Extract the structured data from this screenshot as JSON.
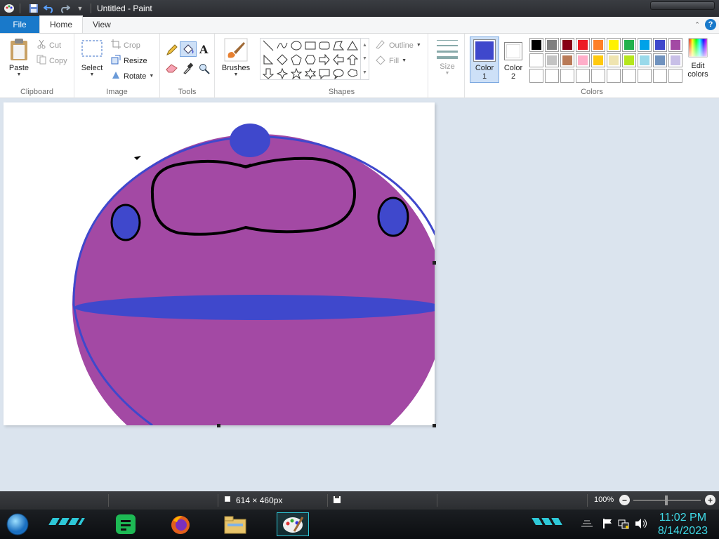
{
  "window": {
    "title": "Untitled - Paint"
  },
  "tabs": [
    {
      "label": "File"
    },
    {
      "label": "Home"
    },
    {
      "label": "View"
    }
  ],
  "ribbon": {
    "clipboard": {
      "group": "Clipboard",
      "paste": "Paste",
      "cut": "Cut",
      "copy": "Copy"
    },
    "image": {
      "group": "Image",
      "select": "Select",
      "crop": "Crop",
      "resize": "Resize",
      "rotate": "Rotate"
    },
    "tools": {
      "group": "Tools"
    },
    "brushes": {
      "label": "Brushes"
    },
    "shapes": {
      "group": "Shapes",
      "outline": "Outline",
      "fill": "Fill"
    },
    "size": {
      "label": "Size"
    },
    "colors": {
      "group": "Colors",
      "color1_label": "Color\n1",
      "color1_label_line1": "Color",
      "color1_label_line2": "1",
      "color2_label_line1": "Color",
      "color2_label_line2": "2",
      "edit_line1": "Edit",
      "edit_line2": "colors",
      "color1": "#3f48cc",
      "color2": "#ffffff",
      "palette_row1": [
        "#000000",
        "#7f7f7f",
        "#880015",
        "#ed1c24",
        "#ff7f27",
        "#fff200",
        "#22b14c",
        "#00a2e8",
        "#3f48cc",
        "#a349a4"
      ],
      "palette_row2": [
        "#ffffff",
        "#c3c3c3",
        "#b97a57",
        "#ffaec9",
        "#ffc90e",
        "#efe4b0",
        "#b5e61d",
        "#99d9ea",
        "#7092be",
        "#c8bfe7"
      ],
      "palette_row3": [
        "#ffffff",
        "#ffffff",
        "#ffffff",
        "#ffffff",
        "#ffffff",
        "#ffffff",
        "#ffffff",
        "#ffffff",
        "#ffffff",
        "#ffffff"
      ]
    }
  },
  "drawing": {
    "body_color": "#a349a4",
    "accent_color": "#3f48cc",
    "outline_color": "#000000"
  },
  "status": {
    "canvas_size": "614 × 460px",
    "zoom": "100%"
  },
  "taskbar": {
    "time": "11:02 PM",
    "date": "8/14/2023"
  }
}
